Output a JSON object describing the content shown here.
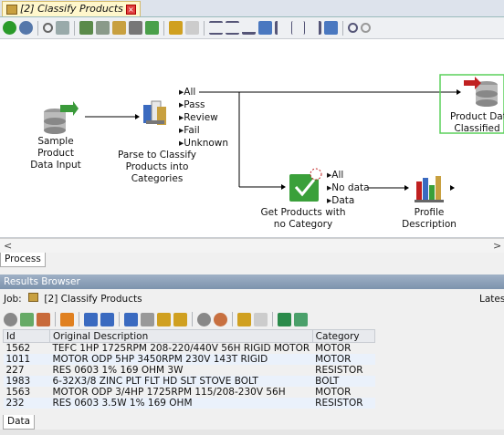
{
  "editor_tab": {
    "title": "[2] Classify Products",
    "close": "×"
  },
  "canvas": {
    "nodes": {
      "sample": {
        "label": "Sample Product\nData Input"
      },
      "parse": {
        "label": "Parse to Classify\nProducts into\nCategories"
      },
      "classified": {
        "label": "Product Dat\nClassified"
      },
      "getproducts": {
        "label": "Get Products with\nno Category"
      },
      "profile": {
        "label": "Profile Description"
      }
    },
    "parse_outputs": [
      "All",
      "Pass",
      "Review",
      "Fail",
      "Unknown"
    ],
    "get_outputs": [
      "All",
      "No data",
      "Data"
    ]
  },
  "scroll": {
    "left": "<",
    "right": ">"
  },
  "process_tab": "Process",
  "results": {
    "header": "Results Browser",
    "job_label": "Job:",
    "job_name": "[2] Classify Products",
    "latest": "Lates",
    "columns": [
      "Id",
      "Original Description",
      "Category"
    ],
    "rows": [
      [
        "1562",
        "TEFC 1HP 1725RPM 208-220/440V 56H RIGID MOTOR",
        "MOTOR"
      ],
      [
        "1011",
        "MOTOR ODP 5HP 3450RPM 230V 143T RIGID",
        "MOTOR"
      ],
      [
        "227",
        "RES 0603 1% 169 OHM 3W",
        "RESISTOR"
      ],
      [
        "1983",
        "6-32X3/8 ZINC PLT FLT HD SLT STOVE BOLT",
        "BOLT"
      ],
      [
        "1563",
        "MOTOR ODP 3/4HP 1725RPM 115/208-230V 56H",
        "MOTOR"
      ],
      [
        "232",
        "RES 0603 3.5W 1% 169 OHM",
        "RESISTOR"
      ]
    ],
    "data_tab": "Data"
  }
}
